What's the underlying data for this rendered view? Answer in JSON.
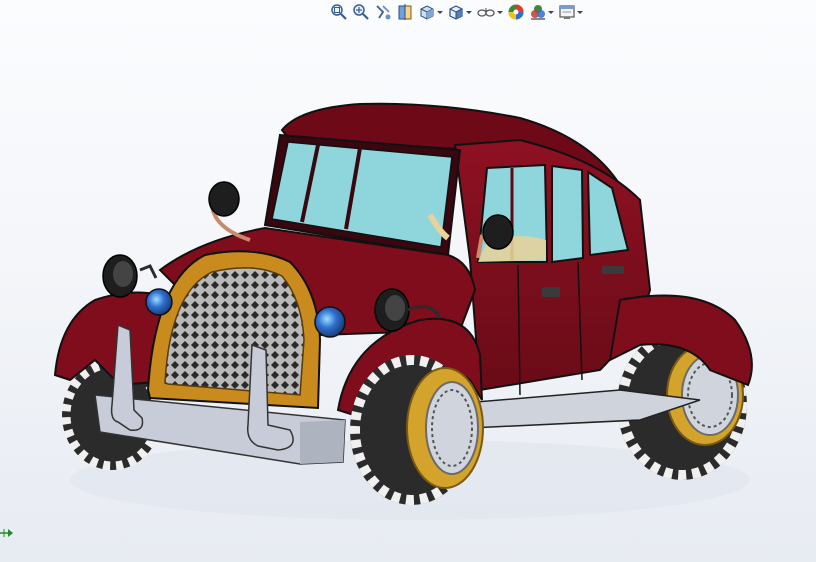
{
  "viewport": {
    "background_top": "#fbfcfe",
    "background_bottom": "#e7ebf2"
  },
  "heads_up_toolbar": {
    "buttons": [
      {
        "icon": "zoom-to-fit-icon",
        "dropdown": false
      },
      {
        "icon": "zoom-to-area-icon",
        "dropdown": false
      },
      {
        "icon": "previous-view-icon",
        "dropdown": false
      },
      {
        "icon": "section-view-icon",
        "dropdown": false
      },
      {
        "icon": "view-orientation-icon",
        "dropdown": true
      },
      {
        "icon": "display-style-icon",
        "dropdown": true
      },
      {
        "icon": "hide-show-items-icon",
        "dropdown": true
      },
      {
        "icon": "edit-appearance-icon",
        "dropdown": false
      },
      {
        "icon": "apply-scene-icon",
        "dropdown": true
      },
      {
        "icon": "view-settings-icon",
        "dropdown": true
      }
    ]
  },
  "model": {
    "name": "vintage car",
    "colors": {
      "body": "#7f0d1b",
      "body_shade": "#5e0914",
      "glass": "#8fd6dc",
      "grille_frame": "#c98a1e",
      "chrome": "#c8ccd8",
      "tire": "#2b2b2b",
      "tread": "#f0f0f0",
      "rim": "#d4a32c"
    }
  },
  "triad": {
    "axis_color": "#1e8c2a"
  }
}
